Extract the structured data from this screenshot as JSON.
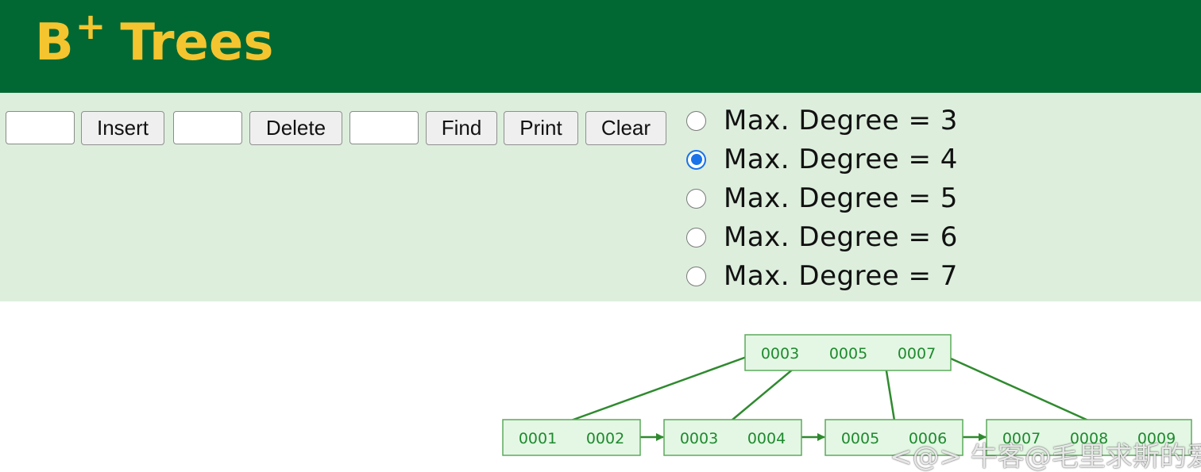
{
  "header": {
    "title_main": "B",
    "title_sup": "+",
    "title_rest": "Trees",
    "background_color": "#026833",
    "title_color": "#f5c52f"
  },
  "controls": {
    "background_color": "#ddeedd",
    "insert_input_value": "",
    "insert_label": "Insert",
    "delete_input_value": "",
    "delete_label": "Delete",
    "find_input_value": "",
    "find_label": "Find",
    "print_label": "Print",
    "clear_label": "Clear",
    "degree_options": [
      {
        "label": "Max. Degree = 3",
        "checked": false
      },
      {
        "label": "Max. Degree = 4",
        "checked": true
      },
      {
        "label": "Max. Degree = 5",
        "checked": false
      },
      {
        "label": "Max. Degree = 6",
        "checked": false
      },
      {
        "label": "Max. Degree = 7",
        "checked": false
      }
    ]
  },
  "tree": {
    "root": {
      "keys": [
        "0003",
        "0005",
        "0007"
      ]
    },
    "leaves": [
      {
        "keys": [
          "0001",
          "0002"
        ]
      },
      {
        "keys": [
          "0003",
          "0004"
        ]
      },
      {
        "keys": [
          "0005",
          "0006"
        ]
      },
      {
        "keys": [
          "0007",
          "0008",
          "0009"
        ]
      }
    ],
    "node_fill": "#e4f7e4",
    "key_color": "#1e8a2e",
    "edge_color": "#2f8a2f"
  },
  "watermark": "<@> 牛客@毛里求斯的爱"
}
